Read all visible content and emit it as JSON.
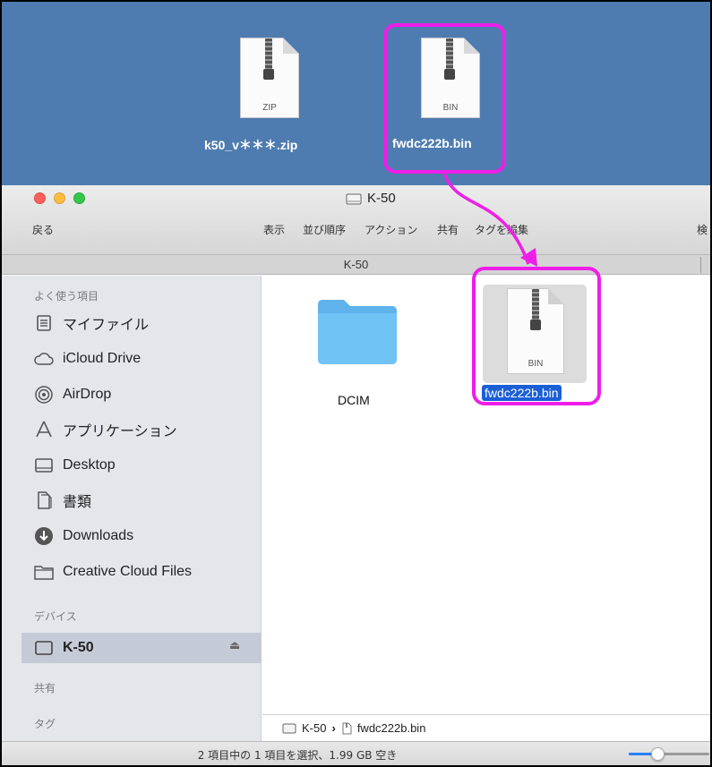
{
  "desktop": {
    "zip_file": {
      "type_label": "ZIP",
      "name": "k50_v＊＊＊.zip"
    },
    "bin_file": {
      "type_label": "BIN",
      "name": "fwdc222b.bin"
    }
  },
  "window": {
    "title": "K-50",
    "back_label": "戻る",
    "toolbar": [
      "表示",
      "並び順序",
      "アクション",
      "共有",
      "タグを編集"
    ],
    "search_label": "検",
    "path_title": "K-50"
  },
  "sidebar": {
    "favorites_header": "よく使う項目",
    "favorites": [
      {
        "label": "マイファイル",
        "icon": "all-my-files-icon"
      },
      {
        "label": "iCloud Drive",
        "icon": "icloud-icon"
      },
      {
        "label": "AirDrop",
        "icon": "airdrop-icon"
      },
      {
        "label": "アプリケーション",
        "icon": "applications-icon"
      },
      {
        "label": "Desktop",
        "icon": "desktop-icon"
      },
      {
        "label": "書類",
        "icon": "documents-icon"
      },
      {
        "label": "Downloads",
        "icon": "downloads-icon"
      },
      {
        "label": "Creative Cloud Files",
        "icon": "folder-icon"
      }
    ],
    "devices_header": "デバイス",
    "device": {
      "label": "K-50",
      "icon": "disk-icon",
      "eject": "⏏"
    },
    "shared_header": "共有",
    "tags_header": "タグ"
  },
  "content": {
    "items": [
      {
        "name": "DCIM",
        "kind": "folder"
      },
      {
        "name": "fwdc222b.bin",
        "kind": "file",
        "type_label": "BIN",
        "selected": true
      }
    ]
  },
  "pathbar": {
    "root": "K-50",
    "separator": "›",
    "file": "fwdc222b.bin"
  },
  "status": {
    "text": "2 項目中の 1 項目を選択、1.99 GB 空き",
    "zoom_fraction": 0.35
  },
  "colors": {
    "highlight": "#ee1ee8",
    "selection": "#1b5fd6",
    "desktop": "#4f7cb0"
  }
}
